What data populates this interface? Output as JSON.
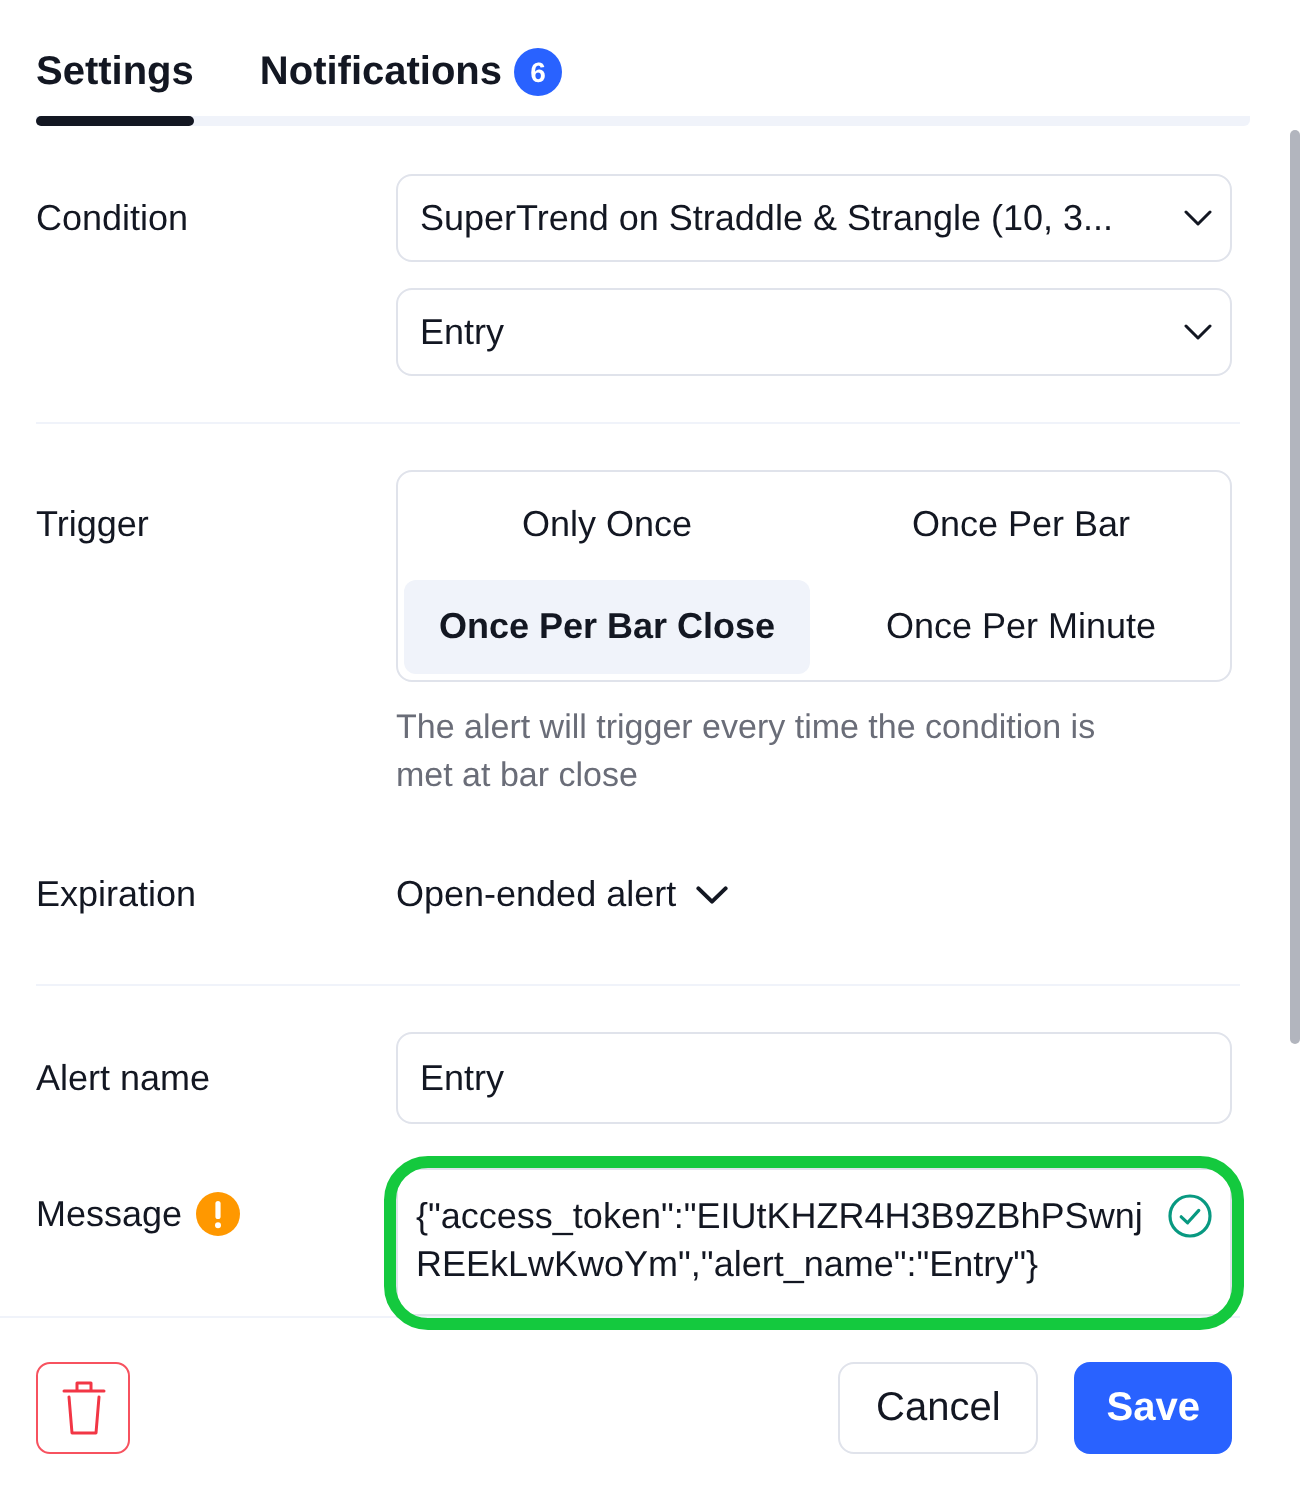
{
  "tabs": [
    {
      "label": "Settings",
      "selected": true
    },
    {
      "label": "Notifications",
      "selected": false,
      "badge": "6"
    }
  ],
  "condition": {
    "label": "Condition",
    "selects": [
      {
        "value": "SuperTrend on Straddle & Strangle (10, 3..."
      },
      {
        "value": "Entry"
      }
    ]
  },
  "trigger": {
    "label": "Trigger",
    "options": [
      {
        "label": "Only Once",
        "selected": false
      },
      {
        "label": "Once Per Bar",
        "selected": false
      },
      {
        "label": "Once Per Bar Close",
        "selected": true
      },
      {
        "label": "Once Per Minute",
        "selected": false
      }
    ],
    "hint": "The alert will trigger every time the condition is met at bar close"
  },
  "expiration": {
    "label": "Expiration",
    "value": "Open-ended alert"
  },
  "alert_name": {
    "label": "Alert name",
    "value": "Entry"
  },
  "message": {
    "label": "Message",
    "warning": true,
    "value": "{\"access_token\":\"EIUtKHZR4H3B9ZBhPSwnjREEkLwKwoYm\",\"alert_name\":\"Entry\"}",
    "valid": true,
    "highlighted": true
  },
  "footer": {
    "buttons": [
      {
        "kind": "delete"
      },
      {
        "kind": "secondary",
        "label": "Cancel"
      },
      {
        "kind": "primary",
        "label": "Save"
      }
    ]
  }
}
